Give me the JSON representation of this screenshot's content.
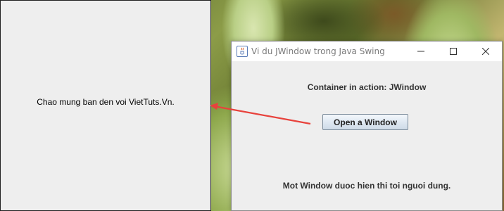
{
  "jwindow": {
    "label": "Chao mung ban den voi VietTuts.Vn."
  },
  "frame": {
    "title": "Vi du JWindow trong Java Swing",
    "heading": "Container in action: JWindow",
    "button_label": "Open a Window",
    "message": "Mot Window duoc hien thi toi nguoi dung."
  },
  "annotation": {
    "arrow_color": "#e8423c"
  },
  "icons": {
    "app": "java-cup-icon",
    "minimize": "minimize-icon",
    "maximize": "maximize-icon",
    "close": "close-icon"
  }
}
